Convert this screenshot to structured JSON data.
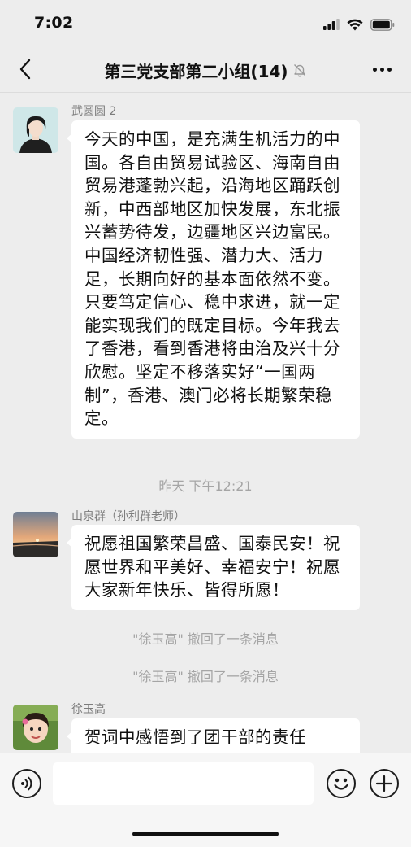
{
  "status_bar": {
    "time": "7:02"
  },
  "nav": {
    "title": "第三党支部第二小组(14)",
    "back_icon": "chevron-left-icon",
    "mute_icon": "bell-off-icon",
    "more_icon": "more-dots-icon"
  },
  "messages": [
    {
      "sender": "武圆圆 2",
      "text": "今天的中国，是充满生机活力的中国。各自由贸易试验区、海南自由贸易港蓬勃兴起，沿海地区踊跃创新，中西部地区加快发展，东北振兴蓄势待发，边疆地区兴边富民。中国经济韧性强、潜力大、活力足，长期向好的基本面依然不变。只要笃定信心、稳中求进，就一定能实现我们的既定目标。今年我去了香港，看到香港将由治及兴十分欣慰。坚定不移落实好“一国两制”，香港、澳门必将长期繁荣稳定。"
    },
    {
      "sender": "山泉群（孙利群老师）",
      "text": "祝愿祖国繁荣昌盛、国泰民安！祝愿世界和平美好、幸福安宁！祝愿大家新年快乐、皆得所愿！"
    },
    {
      "sender": "徐玉高",
      "text": "贺词中感悟到了团干部的责任"
    }
  ],
  "timestamp": "昨天 下午12:21",
  "recall_notices": [
    "\"徐玉高\" 撤回了一条消息",
    "\"徐玉高\" 撤回了一条消息"
  ],
  "input": {
    "value": "",
    "placeholder": ""
  }
}
